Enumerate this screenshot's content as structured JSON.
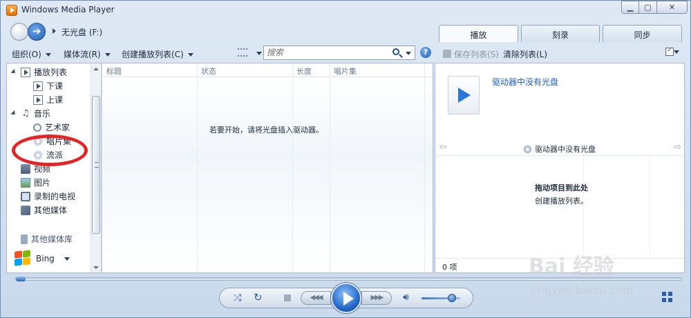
{
  "window": {
    "title": "Windows Media Player"
  },
  "nav": {
    "breadcrumb": "无光盘 (F:)"
  },
  "tabs": [
    {
      "label": "播放"
    },
    {
      "label": "刻录"
    },
    {
      "label": "同步"
    }
  ],
  "toolbar": {
    "organize": "组织(O)",
    "stream": "媒体流(R)",
    "create_playlist": "创建播放列表(C)",
    "search_placeholder": "搜索"
  },
  "right_toolbar": {
    "save_list": "保存列表(S)",
    "clear_list": "清除列表(L)"
  },
  "navpane": {
    "playlists": "播放列表",
    "playlist_items": [
      "下课",
      "上课"
    ],
    "music": "音乐",
    "music_items": [
      "艺术家",
      "唱片集",
      "流派"
    ],
    "video": "视频",
    "pictures": "图片",
    "recorded_tv": "录制的电视",
    "other_media": "其他媒体",
    "other_libraries": "其他媒体库",
    "bing": "Bing"
  },
  "columns": [
    "标题",
    "状态",
    "长度",
    "唱片集"
  ],
  "main": {
    "empty_message": "若要开始，请将光盘插入驱动器。"
  },
  "right_panel": {
    "no_disc": "驱动器中没有光盘",
    "nav_label": "驱动器中没有光盘",
    "drag_title": "拖动项目到此处",
    "drag_subtitle": "创建播放列表。",
    "item_count": "0 项"
  },
  "watermark": {
    "main": "Bai 经验",
    "sub": "jingyan.baidu.com"
  },
  "icons": {
    "back": "back-arrow-icon",
    "forward": "forward-arrow-icon",
    "help": "help-icon",
    "shuffle": "shuffle-icon",
    "repeat": "repeat-icon",
    "volume": "speaker-icon"
  },
  "colors": {
    "accent": "#1f63c4",
    "link": "#1f5fbf",
    "annotation": "#e52525"
  }
}
